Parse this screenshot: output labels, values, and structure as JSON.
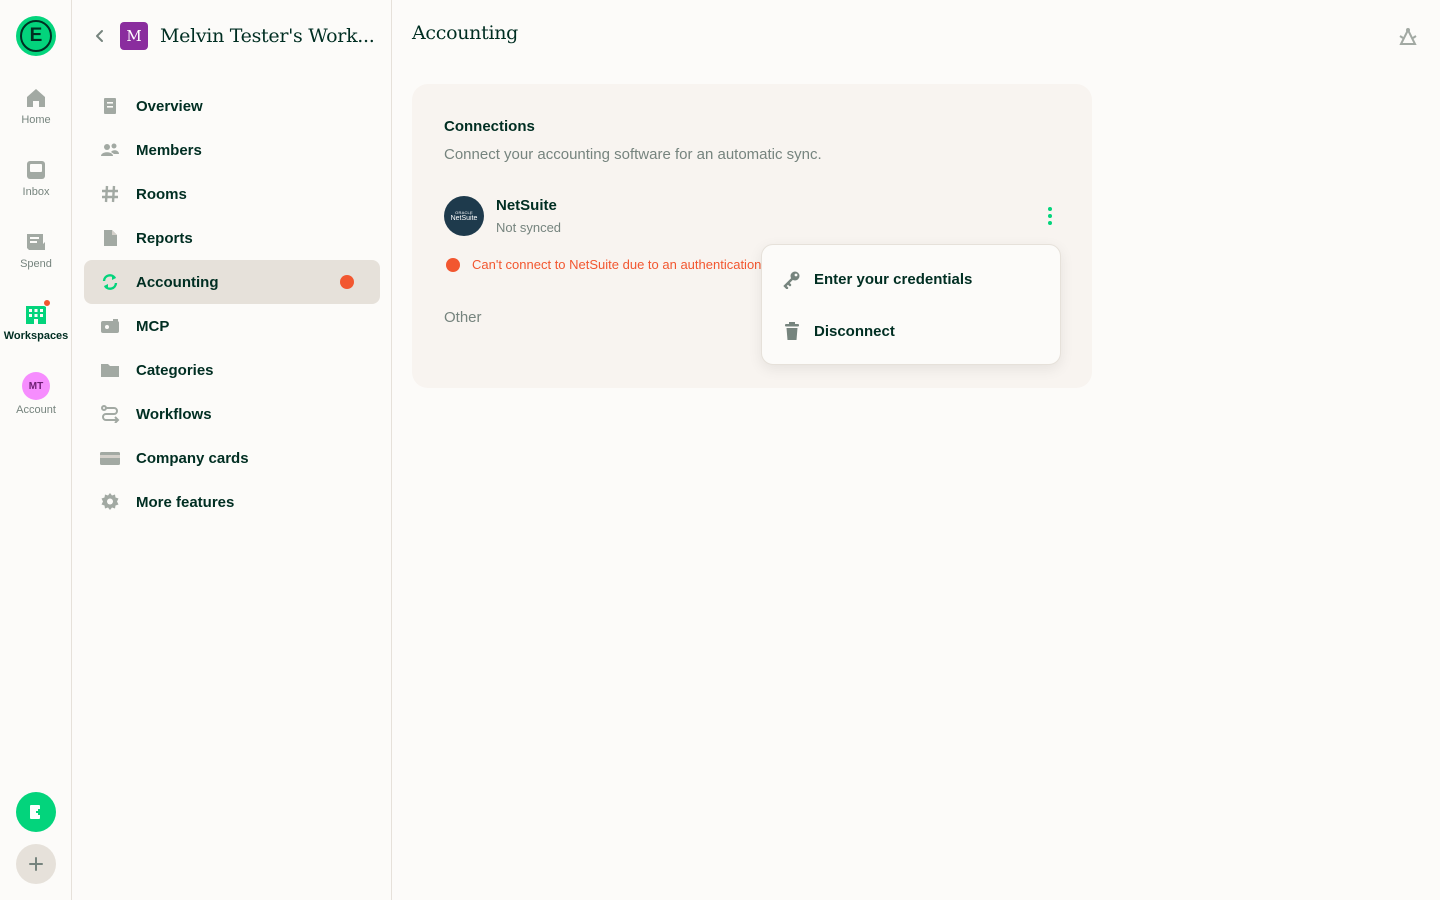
{
  "rail": {
    "logo_letter": "E",
    "items": [
      {
        "label": "Home",
        "icon": "home-icon"
      },
      {
        "label": "Inbox",
        "icon": "inbox-icon"
      },
      {
        "label": "Spend",
        "icon": "receipt-icon"
      },
      {
        "label": "Workspaces",
        "icon": "building-icon"
      },
      {
        "label": "Account",
        "icon": "avatar",
        "initials": "MT"
      }
    ],
    "fab_primary_icon": "new-expense-icon",
    "fab_secondary_icon": "plus-icon"
  },
  "sidebar": {
    "workspace_initial": "M",
    "workspace_name": "Melvin Tester's Work...",
    "items": [
      {
        "label": "Overview",
        "icon": "document-icon"
      },
      {
        "label": "Members",
        "icon": "users-icon"
      },
      {
        "label": "Rooms",
        "icon": "hashtag-icon"
      },
      {
        "label": "Reports",
        "icon": "file-icon"
      },
      {
        "label": "Accounting",
        "icon": "sync-icon",
        "active": true,
        "has_error": true
      },
      {
        "label": "MCP",
        "icon": "mcp-icon"
      },
      {
        "label": "Categories",
        "icon": "folder-icon"
      },
      {
        "label": "Workflows",
        "icon": "workflow-icon"
      },
      {
        "label": "Company cards",
        "icon": "card-icon"
      },
      {
        "label": "More features",
        "icon": "gear-icon"
      }
    ]
  },
  "main": {
    "title": "Accounting",
    "connections": {
      "title": "Connections",
      "subtitle": "Connect your accounting software for an automatic sync.",
      "integration": {
        "logo_top": "ORACLE",
        "logo_name": "NetSuite",
        "name": "NetSuite",
        "status": "Not synced"
      },
      "error": "Can't connect to NetSuite due to an authentication error.",
      "other_label": "Other"
    },
    "popover": {
      "items": [
        {
          "label": "Enter your credentials",
          "icon": "key-icon"
        },
        {
          "label": "Disconnect",
          "icon": "trash-icon"
        }
      ]
    }
  },
  "colors": {
    "brand_green": "#03d47c",
    "text_dark": "#002e22",
    "error_red": "#f25730",
    "muted": "#76847e"
  }
}
